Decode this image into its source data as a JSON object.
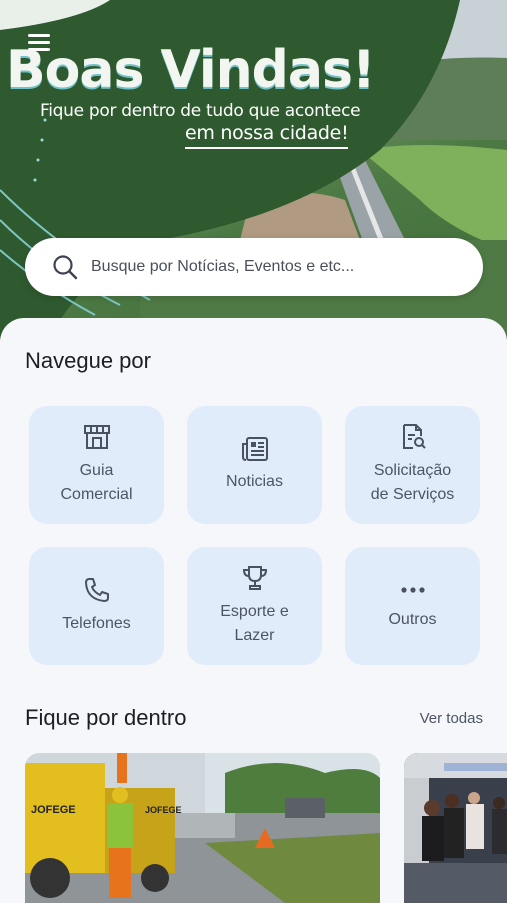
{
  "hero": {
    "title": "Boas Vindas!",
    "subtitle_line1": "Fique por dentro de tudo que acontece",
    "subtitle_line2": "em nossa cidade!"
  },
  "search": {
    "placeholder": "Busque por Notícias, Eventos e etc..."
  },
  "navigate": {
    "title": "Navegue por",
    "items": [
      {
        "label": "Guia\nComercial",
        "icon": "storefront-icon"
      },
      {
        "label": "Noticias",
        "icon": "newspaper-icon"
      },
      {
        "label": "Solicitação\nde Serviços",
        "icon": "document-search-icon"
      },
      {
        "label": "Telefones",
        "icon": "phone-icon"
      },
      {
        "label": "Esporte e\nLazer",
        "icon": "trophy-icon"
      },
      {
        "label": "Outros",
        "icon": "more-dots-icon"
      }
    ]
  },
  "news": {
    "title": "Fique por dentro",
    "see_all": "Ver todas",
    "card1_banner_text": "JOFEGE",
    "card1_banner_text2": "JOFEGE"
  },
  "colors": {
    "tile_bg": "#e1ecfb",
    "hero_green": "#2f5a2f",
    "text_dark": "#1b1e25",
    "text_muted": "#4d5563"
  }
}
